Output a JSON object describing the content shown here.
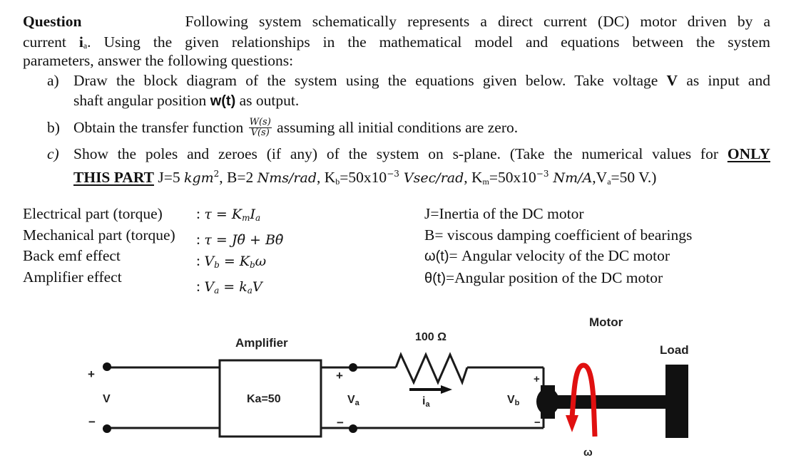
{
  "question": {
    "heading": "Question",
    "intro_line1": "Following system schematically represents a direct current (DC) motor driven by a",
    "intro_line2_pre": "current ",
    "intro_current_symbol": "i",
    "intro_current_sub": "a",
    "intro_line2_post": ". Using the given relationships in the mathematical model and equations between the system",
    "intro_line3": "parameters, answer the following questions:",
    "part_a": {
      "marker": "a)",
      "line1_pre": "Draw the block diagram of the system using the equations given below. Take voltage ",
      "line1_bold": "V",
      "line1_post": " as input and",
      "line2_pre": "shaft angular position ",
      "line2_bold": "w(t)",
      "line2_post": " as output."
    },
    "part_b": {
      "marker": "b)",
      "pre": "Obtain the transfer function ",
      "frac_num": "W(s)",
      "frac_den": "V(s)",
      "post": " assuming all initial conditions are zero."
    },
    "part_c": {
      "marker": "c)",
      "line1_pre": "Show the poles and zeroes (if any) of the system on s-plane. (Take the numerical values for ",
      "line1_bold": "ONLY",
      "line2_bold": "THIS PART",
      "j_value": " J=5 ",
      "j_unit": "kgm",
      "j_unit_sup": "2",
      "b_value": ", B=2 ",
      "b_unit": "Nms/rad",
      "kb_label": ", K",
      "kb_sub": "b",
      "kb_value": "=50x10",
      "kb_exp": "−3",
      "kb_unit": " Vsec/rad",
      "km_label": ", K",
      "km_sub": "m",
      "km_value": "=50x10",
      "km_exp": "−3",
      "km_unit": " Nm/A",
      "va_label": ",V",
      "va_sub": "a",
      "va_value": "=50 V.)"
    }
  },
  "equations": [
    {
      "label": "Electrical part (torque)",
      "lhs": "τ",
      "rhs_html": "K<sub>m</sub>I<sub>a</sub>",
      "rhs_parts": [
        "K",
        "m",
        "I",
        "a"
      ]
    },
    {
      "label": "Mechanical part (torque)",
      "lhs": "τ",
      "rhs_parts": [
        "J",
        "θ̈",
        "+",
        "B",
        "θ̇"
      ]
    },
    {
      "label": "Back emf effect",
      "lhs_parts": [
        "V",
        "b"
      ],
      "rhs_parts": [
        "K",
        "b",
        "ω"
      ]
    },
    {
      "label": "Amplifier effect",
      "lhs_parts": [
        "V",
        "a"
      ],
      "rhs_parts": [
        "k",
        "a",
        "V"
      ]
    }
  ],
  "eq_text": {
    "colon": ": ",
    "equals": " = ",
    "tau": "τ",
    "plus": " + "
  },
  "definitions": [
    {
      "text": "J=Inertia of the DC motor"
    },
    {
      "text": "B= viscous damping coefficient of bearings"
    },
    {
      "symbol": "ω(t)",
      "text": "= Angular velocity of the DC motor"
    },
    {
      "symbol": "θ(t)",
      "text": "=Angular position of the DC motor"
    }
  ],
  "circuit": {
    "input_plus": "+",
    "input_minus": "−",
    "input_label": "V",
    "amplifier_title": "Amplifier",
    "amplifier_gain": "Ka=50",
    "va_plus": "+",
    "va_minus": "−",
    "va_label": "V",
    "va_sub": "a",
    "resistor_label": "100 Ω",
    "current_label": "i",
    "current_sub": "a",
    "vb_label": "V",
    "vb_sub": "b",
    "vb_plus": "+",
    "vb_minus": "−",
    "motor_label": "Motor",
    "load_label": "Load",
    "omega_label": "ω",
    "colors": {
      "wire": "#1a1a1a",
      "rotation_arrow": "#e01010"
    }
  }
}
